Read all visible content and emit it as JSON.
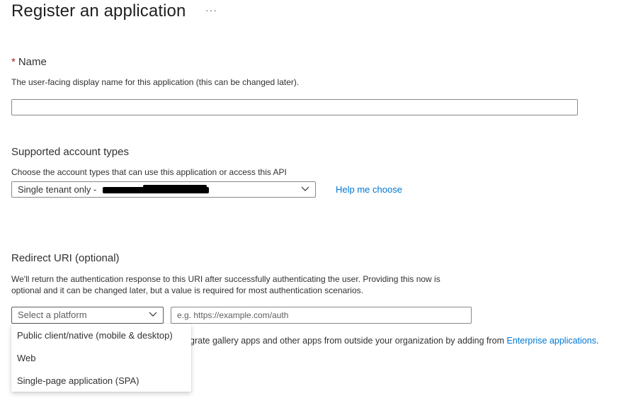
{
  "page": {
    "title": "Register an application",
    "more_label": "···"
  },
  "name_section": {
    "required_mark": "*",
    "label": "Name",
    "description": "The user-facing display name for this application (this can be changed later).",
    "input_value": ""
  },
  "account_types": {
    "label": "Supported account types",
    "description": "Choose the account types that can use this application or access this API",
    "selected_value": "Single tenant only -",
    "help_link": "Help me choose"
  },
  "redirect_uri": {
    "label": "Redirect URI (optional)",
    "description_line1": "We'll return the authentication response to this URI after successfully authenticating the user. Providing this now is",
    "description_line2": "optional and it can be changed later, but a value is required for most authentication scenarios.",
    "platform_placeholder": "Select a platform",
    "uri_placeholder": "e.g. https://example.com/auth",
    "platform_options": [
      "Public client/native (mobile & desktop)",
      "Web",
      "Single-page application (SPA)"
    ]
  },
  "gallery_note": {
    "text_partial": "grate gallery apps and other apps from outside your organization by adding from",
    "link": "Enterprise applications",
    "suffix": "."
  },
  "colors": {
    "accent": "#0078d4",
    "required": "#a4262c",
    "border": "#8a8886",
    "text": "#323130"
  }
}
